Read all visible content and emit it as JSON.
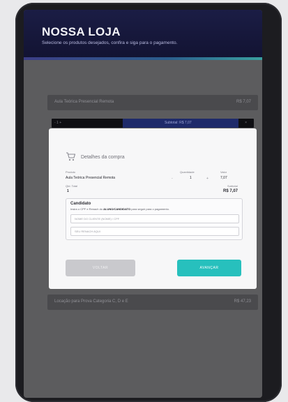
{
  "header": {
    "brand": "NOSSA LOJA",
    "subtitle": "Selecione os produtos desejados, confira e siga para o pagamento."
  },
  "background_items": [
    {
      "title": "Aula Teórica Presencial Remota",
      "price": "R$ 7,07"
    },
    {
      "title": "Locação para Prova Categoria C, D e E",
      "price": "R$ 47,23"
    }
  ],
  "qty_bar": {
    "left": "- 1 +",
    "subtotal": "Subtotal: R$ 7,07",
    "right": "×"
  },
  "modal": {
    "title": "Detalhes da compra",
    "cols": {
      "product": "Produto",
      "qty": "Quantidade",
      "value": "Valor"
    },
    "product_name": "Aula Teórica Presencial Remota",
    "qty": "1",
    "unit_value": "7,07",
    "minus": "-",
    "plus": "+",
    "qty_total_label": "Qtd. Total",
    "qty_total": "1",
    "subtotal_label": "Subtotal",
    "subtotal": "R$ 7,07",
    "candidate": {
      "title": "Candidato",
      "desc_prefix": "Insira o CPF e Renach do ",
      "desc_bold": "ALUNO/CANDIDATO",
      "desc_suffix": " para seguir para o pagamento.",
      "name_placeholder": "NOME DO CLIENTE (NOME) / CPF",
      "renach_placeholder": "SEU RENACH AQUI"
    },
    "back_label": "VOLTAR",
    "next_label": "AVANÇAR"
  }
}
